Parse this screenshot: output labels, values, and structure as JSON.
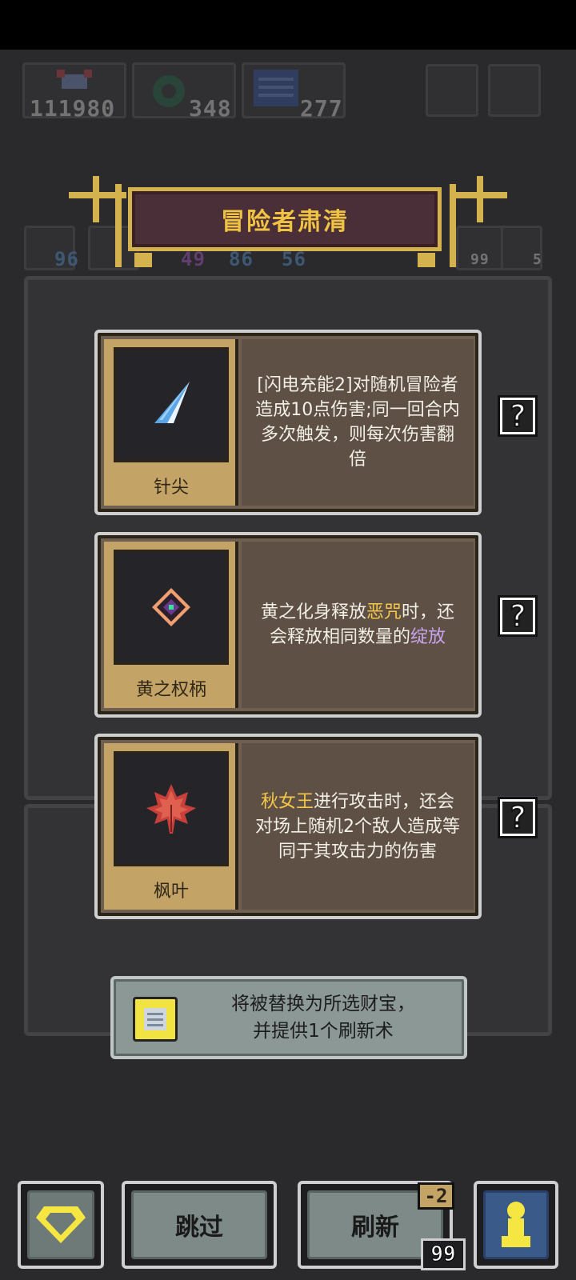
{
  "hud": {
    "resources": [
      {
        "icon": "crab-icon",
        "value": "111980"
      },
      {
        "icon": "green-ring-icon",
        "value": "348"
      },
      {
        "icon": "blue-grid-icon",
        "value": "277"
      }
    ],
    "stats": [
      "96",
      "49",
      "86",
      "56"
    ],
    "right_counts": [
      "99",
      "5"
    ]
  },
  "title": "冒险者肃清",
  "cards": [
    {
      "name": "针尖",
      "icon": "needle-icon",
      "desc_parts": [
        {
          "text": "[闪电充能2]对随机冒险者造成10点伤害;同一回合内多次触发，则每次伤害翻倍",
          "color": "white"
        }
      ]
    },
    {
      "name": "黄之权柄",
      "icon": "yellow-scepter-icon",
      "desc_parts": [
        {
          "text": "黄之化身释放",
          "color": "white"
        },
        {
          "text": "恶咒",
          "color": "gold"
        },
        {
          "text": "时，还会释放相同数量的",
          "color": "white"
        },
        {
          "text": "绽放",
          "color": "purple"
        }
      ]
    },
    {
      "name": "枫叶",
      "icon": "maple-leaf-icon",
      "desc_parts": [
        {
          "text": "秋女王",
          "color": "gold"
        },
        {
          "text": "进行攻击时，还会对场上随机2个敌人造成等同于其攻击力的伤害",
          "color": "white"
        }
      ]
    }
  ],
  "help_glyph": "?",
  "tooltip": {
    "line1": "将被替换为所选财宝，",
    "line2": "并提供1个刷新术"
  },
  "buttons": {
    "skip": "跳过",
    "refresh": "刷新",
    "refresh_cost": "-2",
    "refresh_count": "99"
  },
  "colors": {
    "gold": "#f5c84a",
    "purple": "#c9a4f0",
    "banner_border": "#d4b24e",
    "card_bg": "#6e5f50"
  }
}
